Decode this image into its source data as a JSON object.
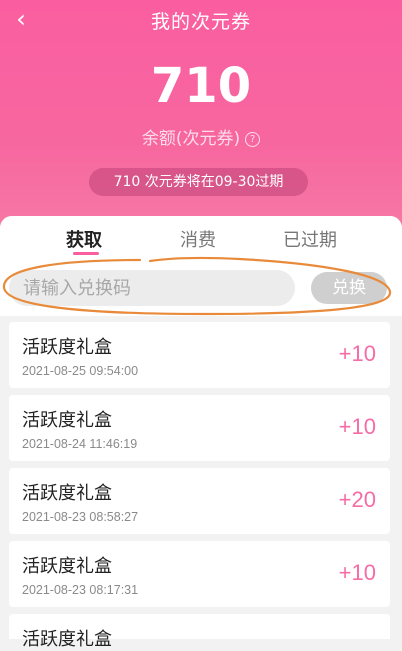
{
  "header": {
    "back_icon": "chevron-left-icon",
    "title": "我的次元券"
  },
  "balance": {
    "amount": "710",
    "label": "余额(次元券)",
    "help_icon": "question-circle-icon",
    "help_glyph": "?"
  },
  "notice": "710 次元券将在09-30过期",
  "tabs": [
    {
      "label": "获取",
      "active": true
    },
    {
      "label": "消费"
    },
    {
      "label": "已过期"
    }
  ],
  "redeem": {
    "placeholder": "请输入兑换码",
    "button": "兑换"
  },
  "records": [
    {
      "name": "活跃度礼盒",
      "time": "2021-08-25 09:54:00",
      "amount": "+10"
    },
    {
      "name": "活跃度礼盒",
      "time": "2021-08-24 11:46:19",
      "amount": "+10"
    },
    {
      "name": "活跃度礼盒",
      "time": "2021-08-23 08:58:27",
      "amount": "+20"
    },
    {
      "name": "活跃度礼盒",
      "time": "2021-08-23 08:17:31",
      "amount": "+10"
    },
    {
      "name": "活跃度礼盒"
    }
  ],
  "colors": {
    "brand": "#fa5ea0",
    "amount": "#f56ca6",
    "annotation": "#e88a3a"
  }
}
